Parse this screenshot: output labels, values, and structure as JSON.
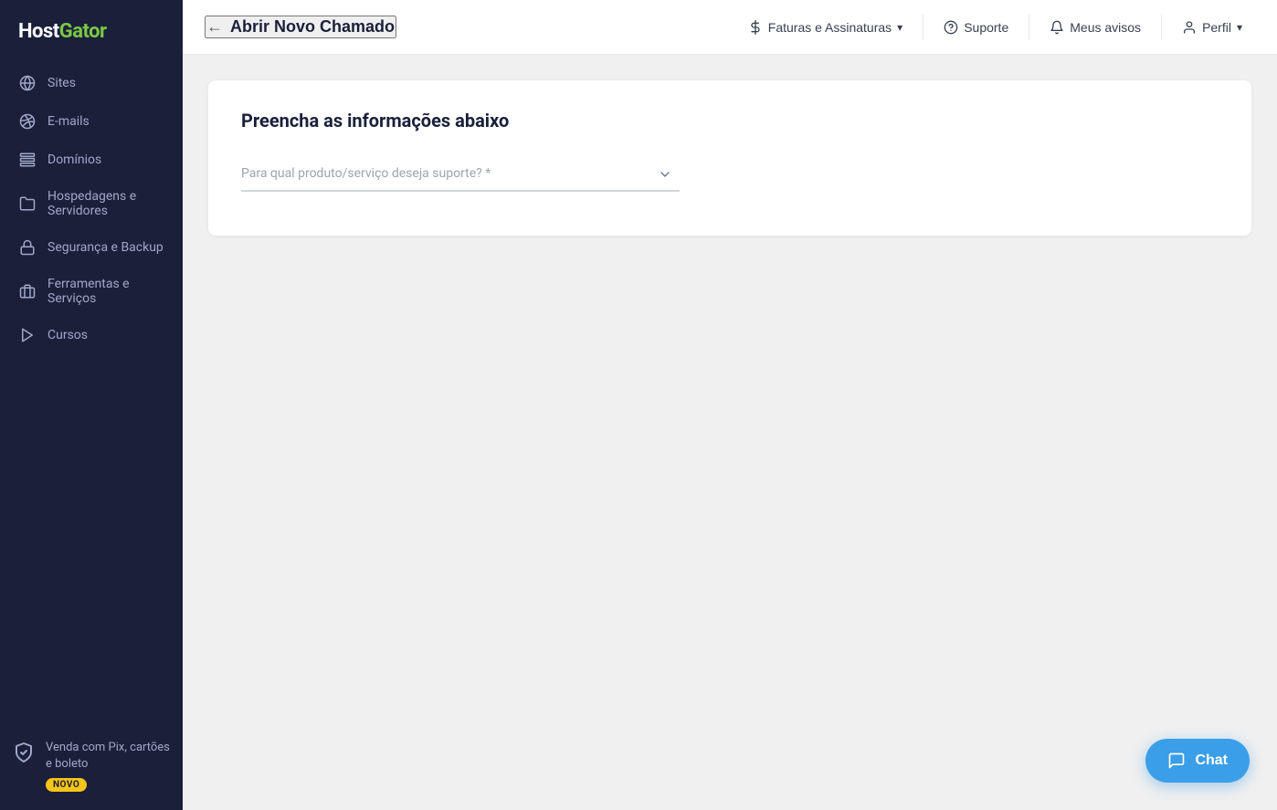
{
  "brand": {
    "name_host": "Host",
    "name_gator": "Gator"
  },
  "sidebar": {
    "items": [
      {
        "id": "sites",
        "label": "Sites",
        "icon": "globe"
      },
      {
        "id": "emails",
        "label": "E-mails",
        "icon": "email"
      },
      {
        "id": "dominios",
        "label": "Domínios",
        "icon": "server"
      },
      {
        "id": "hospedagens",
        "label": "Hospedagens e Servidores",
        "icon": "folder"
      },
      {
        "id": "seguranca",
        "label": "Segurança e Backup",
        "icon": "lock"
      },
      {
        "id": "ferramentas",
        "label": "Ferramentas e Serviços",
        "icon": "tools"
      },
      {
        "id": "cursos",
        "label": "Cursos",
        "icon": "play"
      }
    ],
    "promo": {
      "title": "Venda com Pix, cartões e boleto",
      "badge": "NOVO"
    }
  },
  "topnav": {
    "back_label": "Abrir Novo Chamado",
    "menu_items": [
      {
        "id": "faturas",
        "label": "Faturas e Assinaturas",
        "has_dropdown": true,
        "icon": "dollar"
      },
      {
        "id": "suporte",
        "label": "Suporte",
        "has_dropdown": false,
        "icon": "question"
      },
      {
        "id": "avisos",
        "label": "Meus avisos",
        "has_dropdown": false,
        "icon": "bell"
      },
      {
        "id": "perfil",
        "label": "Perfil",
        "has_dropdown": true,
        "icon": "user"
      }
    ]
  },
  "main": {
    "card_title": "Preencha as informações abaixo",
    "form": {
      "product_placeholder": "Para qual produto/serviço deseja suporte? *"
    }
  },
  "chat": {
    "label": "Chat"
  }
}
